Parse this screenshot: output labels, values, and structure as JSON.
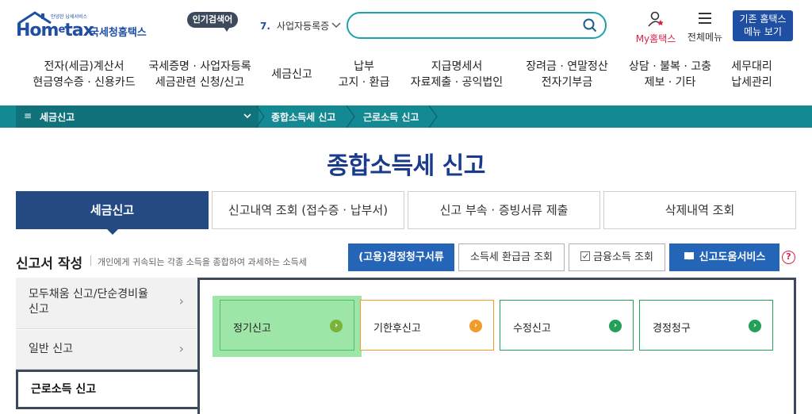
{
  "header": {
    "logo_text_pre": "Hom",
    "logo_text_e": "e",
    "logo_text_post": "tax",
    "logo_tagline": "안녕한 납세서비스",
    "logo_kr": "국세청홈택스",
    "popular_label": "인기검색어",
    "popular_num": "7.",
    "popular_term": "사업자등록증",
    "search_placeholder": "",
    "mytax_label": "My홈택스",
    "allmenu_label": "전체메뉴",
    "old_hometax_line1": "기존 홈택스",
    "old_hometax_line2": "메뉴 보기"
  },
  "gnb": [
    {
      "line1": "전자(세금)계산서",
      "line2": "현금영수증 · 신용카드"
    },
    {
      "line1": "국세증명 · 사업자등록",
      "line2": "세금관련 신청/신고"
    },
    {
      "line1": "세금신고",
      "line2": ""
    },
    {
      "line1": "납부",
      "line2": "고지 · 환급"
    },
    {
      "line1": "지급명세서",
      "line2": "자료제출 · 공익법인"
    },
    {
      "line1": "장려금 · 연말정산",
      "line2": "전자기부금"
    },
    {
      "line1": "상담 · 불복 · 고충",
      "line2": "제보 · 기타"
    },
    {
      "line1": "세무대리",
      "line2": "납세관리"
    }
  ],
  "breadcrumb": {
    "menu_icon": "≡",
    "level1": "세금신고",
    "level2": "종합소득세 신고",
    "level3": "근로소득 신고"
  },
  "page_title": "종합소득세 신고",
  "tabs": [
    {
      "label": "세금신고",
      "active": true
    },
    {
      "label": "신고내역 조회 (접수증 · 납부서)",
      "active": false
    },
    {
      "label": "신고 부속 · 증빙서류 제출",
      "active": false
    },
    {
      "label": "삭제내역 조회",
      "active": false
    }
  ],
  "section": {
    "title": "신고서 작성",
    "desc": "개인에게 귀속되는 각종 소득을 종합하여 과세하는 소득세"
  },
  "actions": {
    "claim_docs": "(고용)경정청구서류",
    "refund_lookup": "소득세 환급금 조회",
    "finance_income": "금융소득 조회",
    "help_service": "신고도움서비스",
    "help_icon": "?"
  },
  "side_menu": [
    {
      "line1": "모두채움 신고/단순경비율",
      "line2": "신고"
    },
    {
      "line1": "일반 신고",
      "line2": ""
    },
    {
      "line1": "근로소득 신고",
      "line2": ""
    }
  ],
  "options": [
    {
      "label": "정기신고",
      "arrow": "›"
    },
    {
      "label": "기한후신고",
      "arrow": "›"
    },
    {
      "label": "수정신고",
      "arrow": "›"
    },
    {
      "label": "경정청구",
      "arrow": "›"
    }
  ],
  "colors": {
    "brand_blue": "#1f4fa3",
    "teal_bar": "#138a93",
    "tab_active": "#244a83",
    "action_blue": "#2565b8",
    "option_green": "#23a05a",
    "option_orange": "#f29a2b",
    "highlight": "#9ee6a7"
  }
}
